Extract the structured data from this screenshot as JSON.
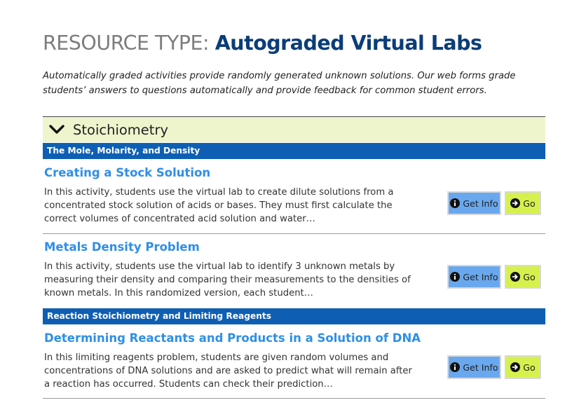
{
  "header": {
    "title_prefix": "RESOURCE TYPE:",
    "title_main": "Autograded Virtual Labs",
    "intro": "Automatically graded activities provide randomly generated unknown solutions. Our web forms grade students’ answers to questions automatically and provide feedback for common student errors."
  },
  "accordion": {
    "label": "Stoichiometry",
    "icon": "chevron-down-icon",
    "background": "#eef5cc"
  },
  "categories": [
    {
      "label": "The Mole, Molarity, and Density",
      "items": [
        {
          "title": "Creating a Stock Solution",
          "description": "In this activity, students use the virtual lab to create dilute solutions from a concentrated stock solution of acids or bases. They must first calculate the correct volumes of concentrated acid solution and water…"
        },
        {
          "title": "Metals Density Problem",
          "description": "In this activity, students use the virtual lab to identify 3 unknown metals by measuring their density and comparing their measurements to the densities of known metals. In this randomized version, each student…"
        }
      ]
    },
    {
      "label": "Reaction Stoichiometry and Limiting Reagents",
      "items": [
        {
          "title": "Determining Reactants and Products in a Solution of DNA",
          "description": "In this limiting reagents problem, students are given random volumes and concentrations of DNA solutions and are asked to predict what will remain after a reaction has occurred. Students can check their prediction…"
        }
      ]
    }
  ],
  "buttons": {
    "info_label": "Get Info",
    "info_icon": "info-icon",
    "go_label": "Go",
    "go_icon": "arrow-right-circle-icon"
  },
  "colors": {
    "title_gray": "#7d7d7d",
    "title_navy": "#0b3d78",
    "category_bar": "#0e5fb3",
    "item_link": "#2f8fe6",
    "info_button": "#69a8ee",
    "go_button": "#d6f14e"
  }
}
